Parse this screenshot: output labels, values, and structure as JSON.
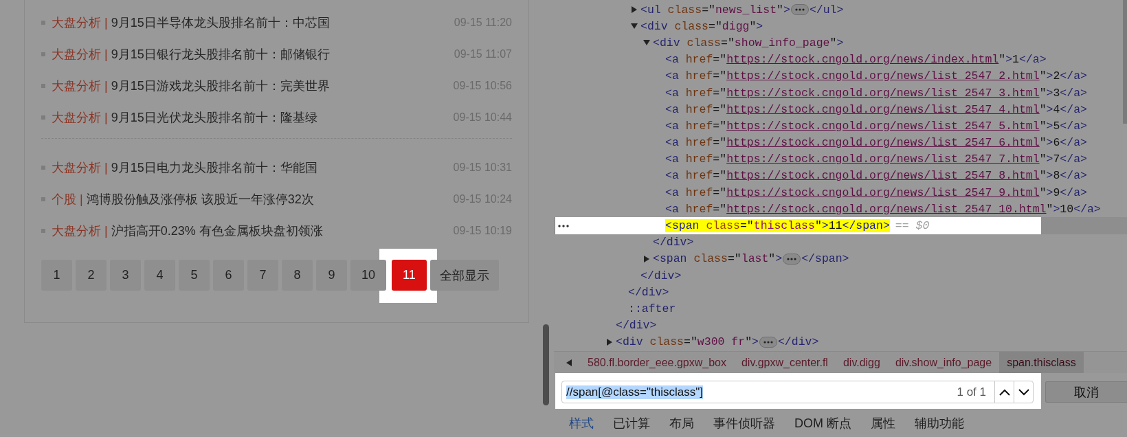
{
  "news_groups": [
    [
      {
        "category": "大盘分析",
        "sep": "|",
        "title": "9月15日半导体龙头股排名前十：中芯国",
        "time": "09-15 11:20"
      },
      {
        "category": "大盘分析",
        "sep": "|",
        "title": "9月15日银行龙头股排名前十：邮储银行",
        "time": "09-15 11:07"
      },
      {
        "category": "大盘分析",
        "sep": "|",
        "title": "9月15日游戏龙头股排名前十：完美世界",
        "time": "09-15 10:56"
      },
      {
        "category": "大盘分析",
        "sep": "|",
        "title": "9月15日光伏龙头股排名前十：隆基绿",
        "time": "09-15 10:44"
      }
    ],
    [
      {
        "category": "大盘分析",
        "sep": "|",
        "title": "9月15日电力龙头股排名前十：华能国",
        "time": "09-15 10:31"
      },
      {
        "category": "个股",
        "sep": "|",
        "title": "鸿博股份触及涨停板 该股近一年涨停32次",
        "time": "09-15 10:24"
      },
      {
        "category": "大盘分析",
        "sep": "|",
        "title": "沪指高开0.23% 有色金属板块盘初领涨",
        "time": "09-15 10:19"
      }
    ]
  ],
  "pagination": {
    "pages": [
      {
        "label": "1",
        "selected": false
      },
      {
        "label": "2",
        "selected": false
      },
      {
        "label": "3",
        "selected": false
      },
      {
        "label": "4",
        "selected": false
      },
      {
        "label": "5",
        "selected": false
      },
      {
        "label": "6",
        "selected": false
      },
      {
        "label": "7",
        "selected": false
      },
      {
        "label": "8",
        "selected": false
      },
      {
        "label": "9",
        "selected": false
      },
      {
        "label": "10",
        "selected": false
      },
      {
        "label": "11",
        "selected": true
      }
    ],
    "show_all": "全部显示"
  },
  "dom_tree": [
    {
      "kind": "tail",
      "close": "</div>",
      "children": [
        {
          "kind": "tail",
          "close": "</div>",
          "children": [
            {
              "kind": "element",
              "expanded": false,
              "open": [
                {
                  "kind": "tag",
                  "text": "<ul"
                },
                {
                  "kind": "attr",
                  "text": " class"
                },
                {
                  "kind": "punct",
                  "text": "=\""
                },
                {
                  "kind": "value",
                  "text": "news_list"
                },
                {
                  "kind": "punct",
                  "text": "\""
                },
                {
                  "kind": "tag",
                  "text": ">"
                }
              ],
              "close": "</ul>"
            },
            {
              "kind": "element",
              "expanded": true,
              "open": [
                {
                  "kind": "tag",
                  "text": "<div"
                },
                {
                  "kind": "attr",
                  "text": " class"
                },
                {
                  "kind": "punct",
                  "text": "=\""
                },
                {
                  "kind": "value",
                  "text": "digg"
                },
                {
                  "kind": "punct",
                  "text": "\""
                },
                {
                  "kind": "tag",
                  "text": ">"
                }
              ],
              "close": "</div>",
              "children": [
                {
                  "kind": "element",
                  "expanded": true,
                  "open": [
                    {
                      "kind": "tag",
                      "text": "<div"
                    },
                    {
                      "kind": "attr",
                      "text": " class"
                    },
                    {
                      "kind": "punct",
                      "text": "=\""
                    },
                    {
                      "kind": "value",
                      "text": "show_info_page"
                    },
                    {
                      "kind": "punct",
                      "text": "\""
                    },
                    {
                      "kind": "tag",
                      "text": ">"
                    }
                  ],
                  "close": "</div>",
                  "children": [
                    {
                      "kind": "leaf",
                      "selected": false,
                      "line": [
                        {
                          "kind": "tag",
                          "text": "<a"
                        },
                        {
                          "kind": "attr",
                          "text": " href"
                        },
                        {
                          "kind": "punct",
                          "text": "=\""
                        },
                        {
                          "kind": "link",
                          "text": "https://stock.cngold.org/news/index.html"
                        },
                        {
                          "kind": "punct",
                          "text": "\""
                        },
                        {
                          "kind": "tag",
                          "text": ">"
                        },
                        {
                          "kind": "text",
                          "text": "1"
                        },
                        {
                          "kind": "tag",
                          "text": "</a>"
                        }
                      ]
                    },
                    {
                      "kind": "leaf",
                      "selected": false,
                      "line": [
                        {
                          "kind": "tag",
                          "text": "<a"
                        },
                        {
                          "kind": "attr",
                          "text": " href"
                        },
                        {
                          "kind": "punct",
                          "text": "=\""
                        },
                        {
                          "kind": "link",
                          "text": "https://stock.cngold.org/news/list_2547_2.html"
                        },
                        {
                          "kind": "punct",
                          "text": "\""
                        },
                        {
                          "kind": "tag",
                          "text": ">"
                        },
                        {
                          "kind": "text",
                          "text": "2"
                        },
                        {
                          "kind": "tag",
                          "text": "</a>"
                        }
                      ]
                    },
                    {
                      "kind": "leaf",
                      "selected": false,
                      "line": [
                        {
                          "kind": "tag",
                          "text": "<a"
                        },
                        {
                          "kind": "attr",
                          "text": " href"
                        },
                        {
                          "kind": "punct",
                          "text": "=\""
                        },
                        {
                          "kind": "link",
                          "text": "https://stock.cngold.org/news/list_2547_3.html"
                        },
                        {
                          "kind": "punct",
                          "text": "\""
                        },
                        {
                          "kind": "tag",
                          "text": ">"
                        },
                        {
                          "kind": "text",
                          "text": "3"
                        },
                        {
                          "kind": "tag",
                          "text": "</a>"
                        }
                      ]
                    },
                    {
                      "kind": "leaf",
                      "selected": false,
                      "line": [
                        {
                          "kind": "tag",
                          "text": "<a"
                        },
                        {
                          "kind": "attr",
                          "text": " href"
                        },
                        {
                          "kind": "punct",
                          "text": "=\""
                        },
                        {
                          "kind": "link",
                          "text": "https://stock.cngold.org/news/list_2547_4.html"
                        },
                        {
                          "kind": "punct",
                          "text": "\""
                        },
                        {
                          "kind": "tag",
                          "text": ">"
                        },
                        {
                          "kind": "text",
                          "text": "4"
                        },
                        {
                          "kind": "tag",
                          "text": "</a>"
                        }
                      ]
                    },
                    {
                      "kind": "leaf",
                      "selected": false,
                      "line": [
                        {
                          "kind": "tag",
                          "text": "<a"
                        },
                        {
                          "kind": "attr",
                          "text": " href"
                        },
                        {
                          "kind": "punct",
                          "text": "=\""
                        },
                        {
                          "kind": "link",
                          "text": "https://stock.cngold.org/news/list_2547_5.html"
                        },
                        {
                          "kind": "punct",
                          "text": "\""
                        },
                        {
                          "kind": "tag",
                          "text": ">"
                        },
                        {
                          "kind": "text",
                          "text": "5"
                        },
                        {
                          "kind": "tag",
                          "text": "</a>"
                        }
                      ]
                    },
                    {
                      "kind": "leaf",
                      "selected": false,
                      "line": [
                        {
                          "kind": "tag",
                          "text": "<a"
                        },
                        {
                          "kind": "attr",
                          "text": " href"
                        },
                        {
                          "kind": "punct",
                          "text": "=\""
                        },
                        {
                          "kind": "link",
                          "text": "https://stock.cngold.org/news/list_2547_6.html"
                        },
                        {
                          "kind": "punct",
                          "text": "\""
                        },
                        {
                          "kind": "tag",
                          "text": ">"
                        },
                        {
                          "kind": "text",
                          "text": "6"
                        },
                        {
                          "kind": "tag",
                          "text": "</a>"
                        }
                      ]
                    },
                    {
                      "kind": "leaf",
                      "selected": false,
                      "line": [
                        {
                          "kind": "tag",
                          "text": "<a"
                        },
                        {
                          "kind": "attr",
                          "text": " href"
                        },
                        {
                          "kind": "punct",
                          "text": "=\""
                        },
                        {
                          "kind": "link",
                          "text": "https://stock.cngold.org/news/list_2547_7.html"
                        },
                        {
                          "kind": "punct",
                          "text": "\""
                        },
                        {
                          "kind": "tag",
                          "text": ">"
                        },
                        {
                          "kind": "text",
                          "text": "7"
                        },
                        {
                          "kind": "tag",
                          "text": "</a>"
                        }
                      ]
                    },
                    {
                      "kind": "leaf",
                      "selected": false,
                      "line": [
                        {
                          "kind": "tag",
                          "text": "<a"
                        },
                        {
                          "kind": "attr",
                          "text": " href"
                        },
                        {
                          "kind": "punct",
                          "text": "=\""
                        },
                        {
                          "kind": "link",
                          "text": "https://stock.cngold.org/news/list_2547_8.html"
                        },
                        {
                          "kind": "punct",
                          "text": "\""
                        },
                        {
                          "kind": "tag",
                          "text": ">"
                        },
                        {
                          "kind": "text",
                          "text": "8"
                        },
                        {
                          "kind": "tag",
                          "text": "</a>"
                        }
                      ]
                    },
                    {
                      "kind": "leaf",
                      "selected": false,
                      "line": [
                        {
                          "kind": "tag",
                          "text": "<a"
                        },
                        {
                          "kind": "attr",
                          "text": " href"
                        },
                        {
                          "kind": "punct",
                          "text": "=\""
                        },
                        {
                          "kind": "link",
                          "text": "https://stock.cngold.org/news/list_2547_9.html"
                        },
                        {
                          "kind": "punct",
                          "text": "\""
                        },
                        {
                          "kind": "tag",
                          "text": ">"
                        },
                        {
                          "kind": "text",
                          "text": "9"
                        },
                        {
                          "kind": "tag",
                          "text": "</a>"
                        }
                      ]
                    },
                    {
                      "kind": "leaf",
                      "selected": false,
                      "line": [
                        {
                          "kind": "tag",
                          "text": "<a"
                        },
                        {
                          "kind": "attr",
                          "text": " href"
                        },
                        {
                          "kind": "punct",
                          "text": "=\""
                        },
                        {
                          "kind": "link",
                          "text": "https://stock.cngold.org/news/list_2547_10.html"
                        },
                        {
                          "kind": "punct",
                          "text": "\""
                        },
                        {
                          "kind": "tag",
                          "text": ">"
                        },
                        {
                          "kind": "text",
                          "text": "10"
                        },
                        {
                          "kind": "tag",
                          "text": "</a>"
                        }
                      ]
                    },
                    {
                      "kind": "leaf",
                      "selected": true,
                      "marker": "== $0",
                      "line": [
                        {
                          "kind": "tag",
                          "text": "<span"
                        },
                        {
                          "kind": "attr",
                          "text": " class"
                        },
                        {
                          "kind": "punct",
                          "text": "=\""
                        },
                        {
                          "kind": "value",
                          "text": "thisclass"
                        },
                        {
                          "kind": "punct",
                          "text": "\""
                        },
                        {
                          "kind": "tag",
                          "text": ">"
                        },
                        {
                          "kind": "text",
                          "text": "11"
                        },
                        {
                          "kind": "tag",
                          "text": "</span>"
                        }
                      ]
                    }
                  ]
                },
                {
                  "kind": "element",
                  "expanded": false,
                  "open": [
                    {
                      "kind": "tag",
                      "text": "<span"
                    },
                    {
                      "kind": "attr",
                      "text": " class"
                    },
                    {
                      "kind": "punct",
                      "text": "=\""
                    },
                    {
                      "kind": "value",
                      "text": "last"
                    },
                    {
                      "kind": "punct",
                      "text": "\""
                    },
                    {
                      "kind": "tag",
                      "text": ">"
                    }
                  ],
                  "close": "</span>"
                }
              ]
            }
          ]
        },
        {
          "kind": "pseudo",
          "label": "::after"
        }
      ]
    },
    {
      "kind": "element",
      "expanded": false,
      "open": [
        {
          "kind": "tag",
          "text": "<div"
        },
        {
          "kind": "attr",
          "text": " class"
        },
        {
          "kind": "punct",
          "text": "=\""
        },
        {
          "kind": "value",
          "text": "w300 fr"
        },
        {
          "kind": "punct",
          "text": "\""
        },
        {
          "kind": "tag",
          "text": ">"
        }
      ],
      "close": "</div>"
    }
  ],
  "breadcrumbs": [
    {
      "label": "580.fl.border_eee.gpxw_box",
      "selected": false
    },
    {
      "label": "div.gpxw_center.fl",
      "selected": false
    },
    {
      "label": "div.digg",
      "selected": false
    },
    {
      "label": "div.show_info_page",
      "selected": false
    },
    {
      "label": "span.thisclass",
      "selected": true
    }
  ],
  "search": {
    "value": "//span[@class=\"thisclass\"]",
    "count": "1 of 1",
    "cancel": "取消"
  },
  "tabs": [
    {
      "label": "样式",
      "selected": true
    },
    {
      "label": "已计算",
      "selected": false
    },
    {
      "label": "布局",
      "selected": false
    },
    {
      "label": "事件侦听器",
      "selected": false
    },
    {
      "label": "DOM 断点",
      "selected": false
    },
    {
      "label": "属性",
      "selected": false
    },
    {
      "label": "辅助功能",
      "selected": false
    }
  ]
}
